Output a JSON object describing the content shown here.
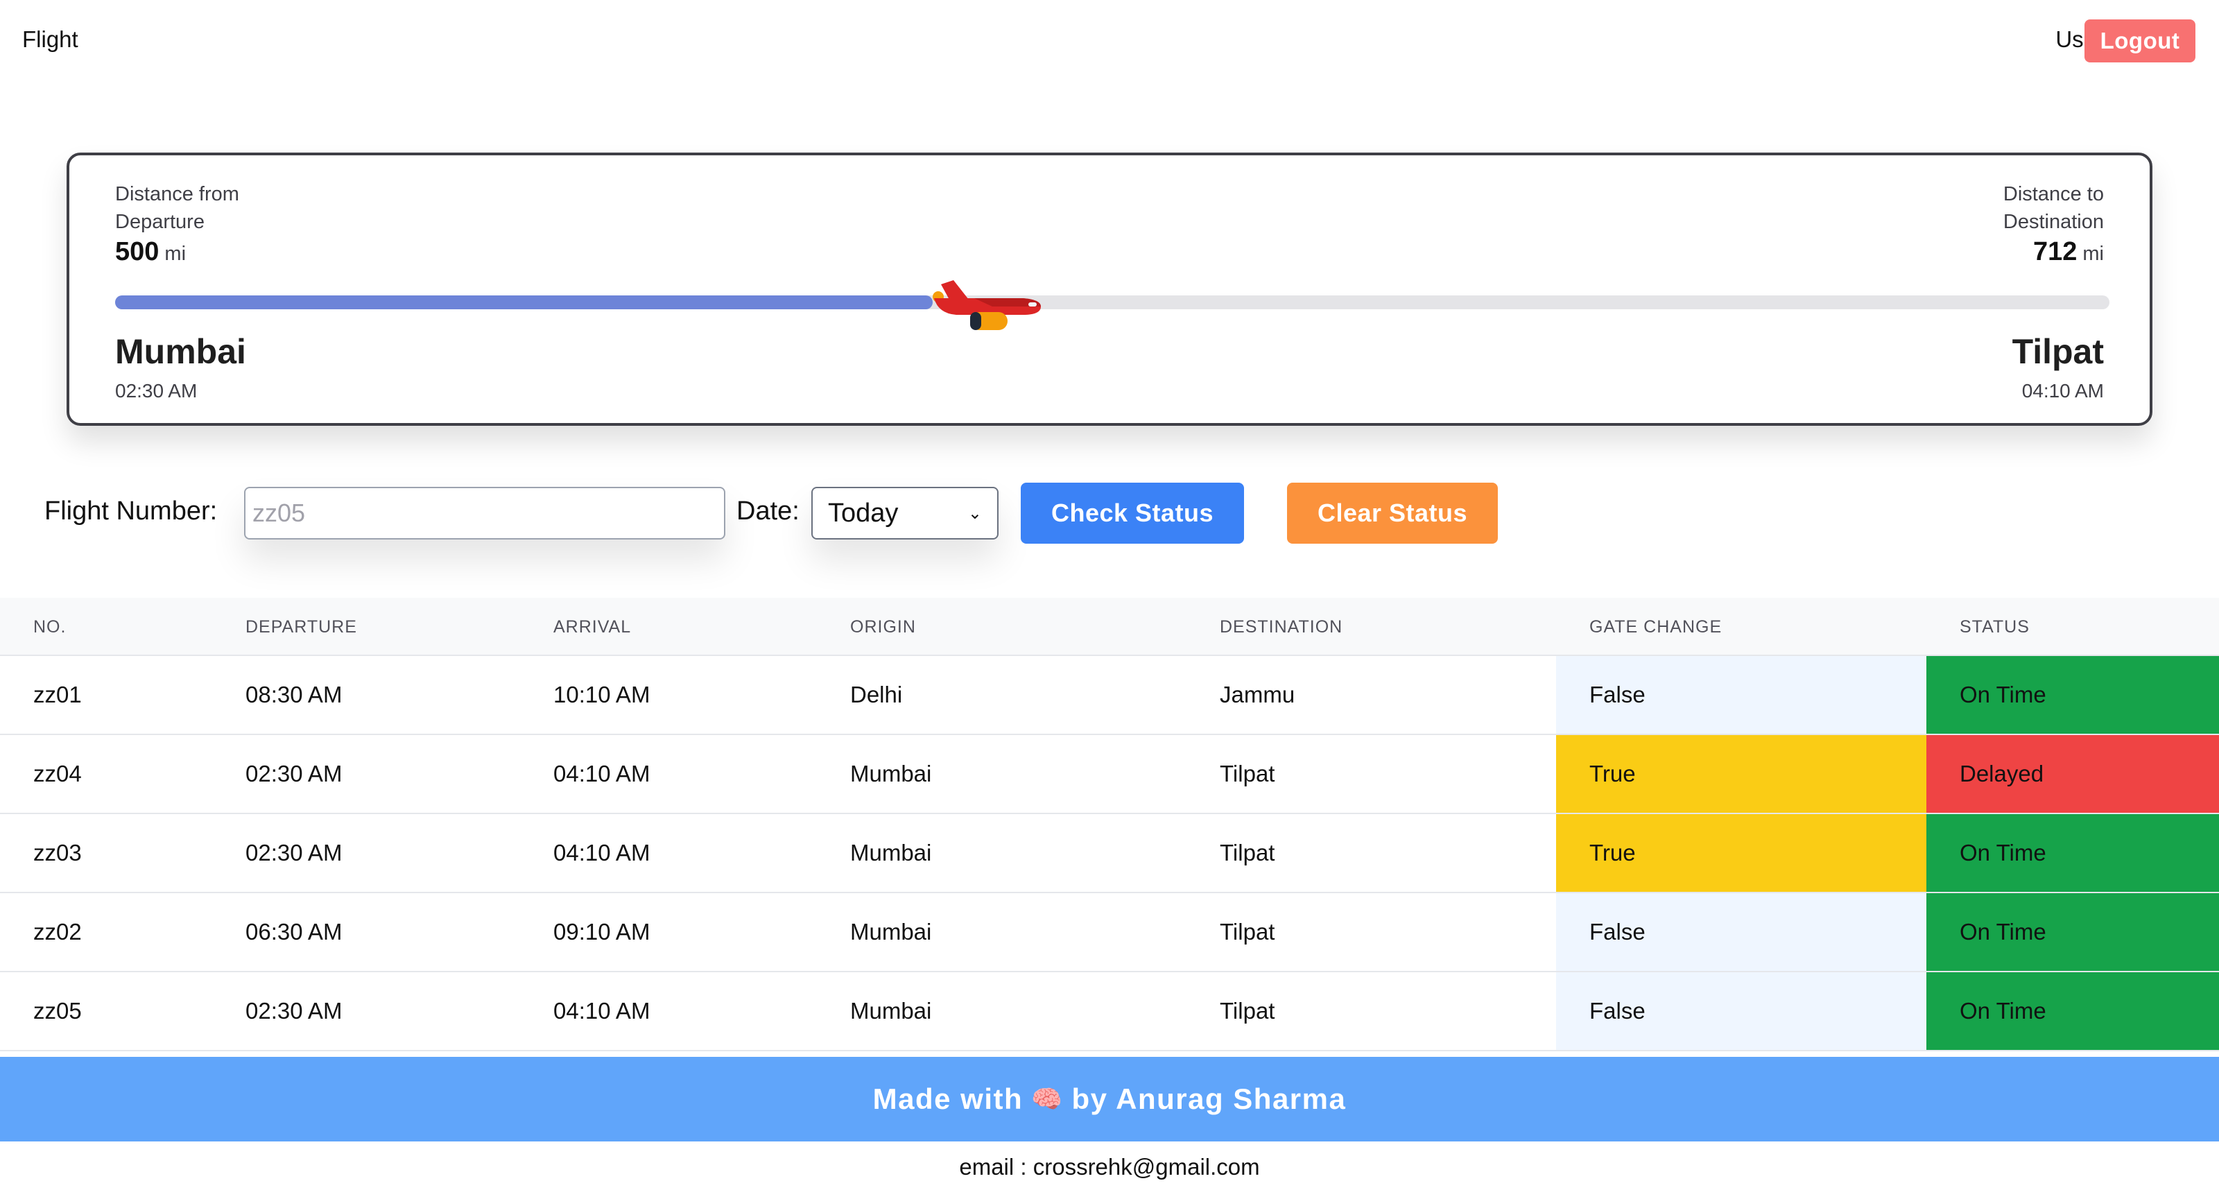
{
  "nav": {
    "brand": "Flight",
    "user": "User",
    "logout": "Logout"
  },
  "tracker": {
    "departure_label": "Distance from Departure",
    "departure_distance": "500",
    "destination_label": "Distance to Destination",
    "destination_distance": "712",
    "unit": "mi",
    "progress_fraction": 0.41,
    "origin_city": "Mumbai",
    "origin_time": "02:30 AM",
    "destination_city": "Tilpat",
    "destination_time": "04:10 AM"
  },
  "form": {
    "flight_number_label": "Flight Number:",
    "flight_number_placeholder": "zz05",
    "date_label": "Date:",
    "date_selected": "Today",
    "check_button": "Check Status",
    "clear_button": "Clear Status"
  },
  "table": {
    "headers": {
      "no": "NO.",
      "departure": "DEPARTURE",
      "arrival": "ARRIVAL",
      "origin": "ORIGIN",
      "destination": "DESTINATION",
      "gate": "GATE CHANGE",
      "status": "STATUS"
    },
    "rows": [
      {
        "no": "zz01",
        "departure": "08:30 AM",
        "arrival": "10:10 AM",
        "origin": "Delhi",
        "destination": "Jammu",
        "gate": "False",
        "status": "On Time"
      },
      {
        "no": "zz04",
        "departure": "02:30 AM",
        "arrival": "04:10 AM",
        "origin": "Mumbai",
        "destination": "Tilpat",
        "gate": "True",
        "status": "Delayed"
      },
      {
        "no": "zz03",
        "departure": "02:30 AM",
        "arrival": "04:10 AM",
        "origin": "Mumbai",
        "destination": "Tilpat",
        "gate": "True",
        "status": "On Time"
      },
      {
        "no": "zz02",
        "departure": "06:30 AM",
        "arrival": "09:10 AM",
        "origin": "Mumbai",
        "destination": "Tilpat",
        "gate": "False",
        "status": "On Time"
      },
      {
        "no": "zz05",
        "departure": "02:30 AM",
        "arrival": "04:10 AM",
        "origin": "Mumbai",
        "destination": "Tilpat",
        "gate": "False",
        "status": "On Time"
      }
    ]
  },
  "colors": {
    "gate_true": "#facc15",
    "gate_false": "#eff6ff",
    "status_on_time": "#16a34a",
    "status_delayed": "#ef4444"
  },
  "footer": {
    "made_with": "Made with",
    "icon": "brain-icon",
    "by": "by Anurag Sharma",
    "email": "email : crossrehk@gmail.com"
  }
}
